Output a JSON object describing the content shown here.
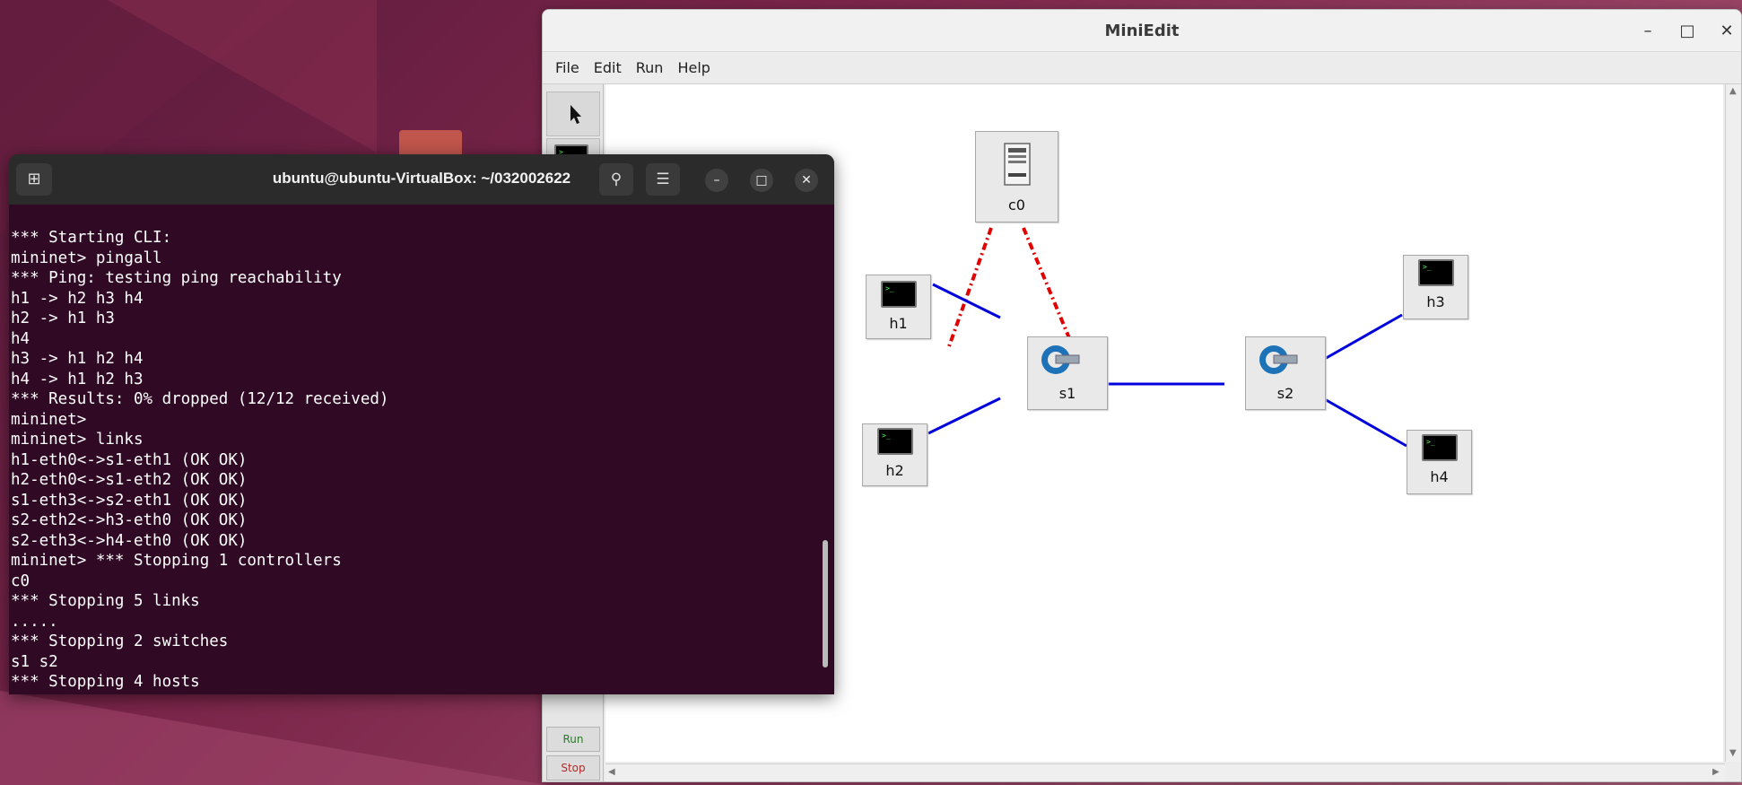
{
  "miniedit": {
    "title": "MiniEdit",
    "menu": [
      "File",
      "Edit",
      "Run",
      "Help"
    ],
    "toolbar": {
      "run_label": "Run",
      "stop_label": "Stop"
    },
    "nodes": {
      "c0": "c0",
      "s1": "s1",
      "s2": "s2",
      "h1": "h1",
      "h2": "h2",
      "h3": "h3",
      "h4": "h4"
    },
    "colors": {
      "data_link": "#0000dd",
      "controller_link": "#e00000"
    }
  },
  "terminal": {
    "title": "ubuntu@ubuntu-VirtualBox: ~/032002622",
    "lines": [
      "*** Starting CLI:",
      "mininet> pingall",
      "*** Ping: testing ping reachability",
      "h1 -> h2 h3 h4",
      "h2 -> h1 h3",
      "h4",
      "h3 -> h1 h2 h4",
      "h4 -> h1 h2 h3",
      "*** Results: 0% dropped (12/12 received)",
      "mininet>",
      "mininet> links",
      "h1-eth0<->s1-eth1 (OK OK)",
      "h2-eth0<->s1-eth2 (OK OK)",
      "s1-eth3<->s2-eth1 (OK OK)",
      "s2-eth2<->h3-eth0 (OK OK)",
      "s2-eth3<->h4-eth0 (OK OK)",
      "mininet> *** Stopping 1 controllers",
      "c0",
      "*** Stopping 5 links",
      ".....",
      "*** Stopping 2 switches",
      "s1 s2",
      "*** Stopping 4 hosts"
    ],
    "colors": {
      "background": "#300a24",
      "text": "#ffffff"
    }
  }
}
